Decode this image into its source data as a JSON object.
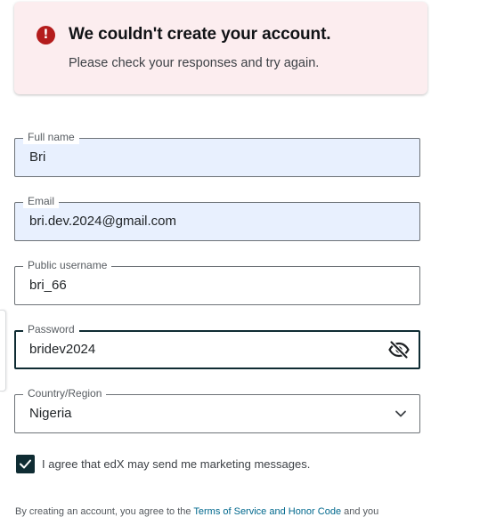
{
  "alert": {
    "title": "We couldn't create your account.",
    "message": "Please check your responses and try again.",
    "icon": "error-icon",
    "icon_glyph": "!",
    "color": "#b41c1c",
    "background": "#fcedef"
  },
  "form": {
    "full_name": {
      "label": "Full name",
      "value": "Bri"
    },
    "email": {
      "label": "Email",
      "value": "bri.dev.2024@gmail.com"
    },
    "username": {
      "label": "Public username",
      "value": "bri_66"
    },
    "password": {
      "label": "Password",
      "value": "bridev2024",
      "toggle_icon": "eye-slash-icon"
    },
    "country": {
      "label": "Country/Region",
      "value": "Nigeria",
      "icon": "chevron-down-icon"
    }
  },
  "marketing": {
    "label": "I agree that edX may send me marketing messages.",
    "checked": true,
    "icon": "checkmark-icon"
  },
  "terms": {
    "prefix": "By creating an account, you agree to the ",
    "link_text": "Terms of Service and Honor Code",
    "suffix": " and you"
  },
  "colors": {
    "primary": "#0f2c33",
    "autofill_bg": "#e8f0fe",
    "link": "#00688d"
  }
}
